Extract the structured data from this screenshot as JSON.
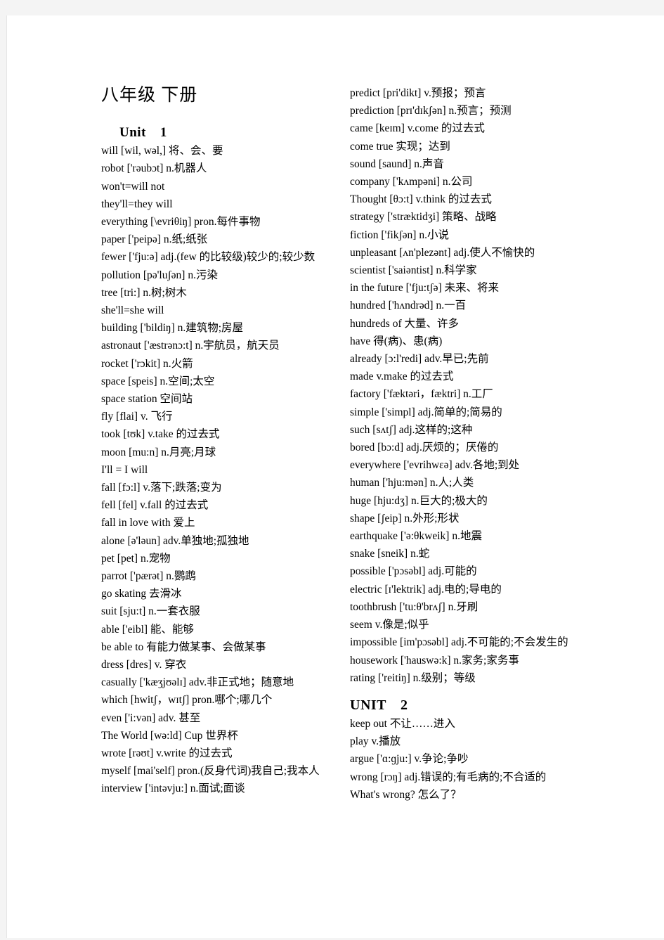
{
  "document": {
    "title": "八年级  下册",
    "page_background": "#f4f4f4",
    "paper_color": "#ffffff"
  },
  "left_column": {
    "unit_heading": {
      "label": "Unit",
      "number": "1"
    },
    "entries": [
      "will     [wil,   wəl,]     将、会、要",
      "robot  ['rəubɔt]  n.机器人",
      "won't=will  not",
      "they'll=they  will",
      "everything     [\\evriθiŋ]    pron.每件事物",
      "paper  ['peipə]    n.纸;纸张",
      "fewer  ['fju:ə]    adj.(few 的比较级)较少的;较少数",
      "pollution  [pə'luʃən]    n.污染",
      "tree    [tri:]    n.树;树木",
      "she'll=she  will",
      "building  ['bildiŋ]    n.建筑物;房屋",
      "astronaut     ['æstrənɔ:t]     n.宇航员，航天员",
      "rocket  ['rɔkit]    n.火箭",
      "space    [speis]  n.空间;太空",
      "space  station   空间站",
      "fly      [flai]    v. 飞行",
      "took    [tʊk]  v.take 的过去式",
      "moon    [mu:n]  n.月亮;月球",
      "I'll  =  I  will",
      "fall    [fɔ:l]    v.落下;跌落;变为",
      "fell    [fel]    v.fall 的过去式",
      "fall  in  love  with   爱上",
      "alone    [ə'ləun]    adv.单独地;孤独地",
      "pet    [pet]    n.宠物",
      "parrot      ['pærət]    n.鹦鹉",
      "go  skating 去滑冰",
      "suit    [sju:t]    n.一套衣服",
      "able    ['eibl]    能、能够",
      "be  able  to   有能力做某事、会做某事",
      "dress    [dres]    v. 穿衣",
      "casually     ['kæʒjʊəlɪ]   adv.非正式地；随意地",
      "which     [hwitʃ，wɪtʃ]   pron.哪个;哪几个",
      "even     ['i:vən]   adv. 甚至",
      "The  World    [wə:ld]    Cup  世界杯",
      "wrote     [rəʊt]    v.write 的过去式",
      "myself    [mai'self]    pron.(反身代词)我自己;我本人",
      "interview    ['intəvju:]    n.面试;面谈"
    ]
  },
  "right_column": {
    "unit_heading": {
      "label": "UNIT",
      "number": "2"
    },
    "entries_before_unit": [
      "predict    [pri'dikt]    v.预报；预言",
      "prediction     [prɪ'dɪkʃən]   n.预言；预测",
      "came    [keɪm]   v.come 的过去式",
      "come  true   实现；达到",
      "sound    [saund]    n.声音",
      "company    ['kʌmpəni]    n.公司",
      "Thought     [θɔ:t]    v.think 的过去式",
      "strategy   ['stræktidʒi]   策略、战略",
      "fiction     ['fikʃən]   n.小说",
      "unpleasant     [ʌn'plezənt]    adj.使人不愉快的",
      "scientist    ['saiəntist]   n.科学家",
      "in  the  future     ['fju:tʃə]   未来、将来",
      "hundred    ['hʌndrəd]    n.一百",
      "hundreds  of      大量、许多",
      "have 得(病)、患(病)",
      "already    [ɔ:l'redi]    adv.早已;先前",
      "made  v.make 的过去式",
      "factory    ['fæktəri，fæktri]    n.工厂",
      "simple    ['simpl]   adj.简单的;简易的",
      "such    [sʌtʃ]   adj.这样的;这种",
      "bored    [bɔ:d]    adj.厌烦的；厌倦的",
      "everywhere     ['evrihwεə] adv.各地;到处",
      "human    ['hju:mən]    n.人;人类",
      "huge    [hju:dʒ]   n.巨大的;极大的",
      "shape    [ʃeip]    n.外形;形状",
      "earthquake  ['ə:θkweik]    n.地震",
      "snake    [sneik]    n.蛇",
      "possible    ['pɔsəbl]   adj.可能的",
      "electric  [ɪ'lektrik]    adj.电的;导电的",
      "toothbrush    ['tu:θ'brʌʃ]    n.牙刷",
      "seem v.像是;似乎",
      "impossible    [im'pɔsəbl]    adj.不可能的;不会发生的",
      "housework  ['hauswə:k]    n.家务;家务事",
      "rating    ['reitiŋ]    n.级别；等级"
    ],
    "entries_after_unit": [
      "keep  out  不让……进入",
      "play v.播放",
      "argue     ['ɑ:ɡju:]   v.争论;争吵",
      "wrong    [rɔŋ]   adj.错误的;有毛病的;不合适的",
      "What's  wrong?      怎么了？"
    ]
  }
}
